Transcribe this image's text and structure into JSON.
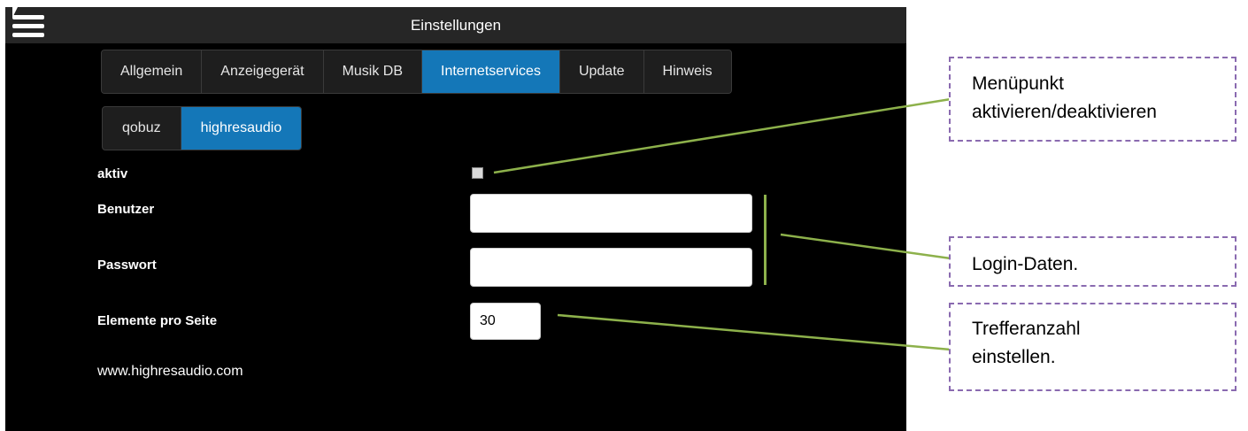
{
  "window": {
    "title": "Einstellungen"
  },
  "main_tabs": [
    {
      "label": "Allgemein",
      "active": false
    },
    {
      "label": "Anzeigegerät",
      "active": false
    },
    {
      "label": "Musik DB",
      "active": false
    },
    {
      "label": "Internetservices",
      "active": true
    },
    {
      "label": "Update",
      "active": false
    },
    {
      "label": "Hinweis",
      "active": false
    }
  ],
  "sub_tabs": [
    {
      "label": "qobuz",
      "active": false
    },
    {
      "label": "highresaudio",
      "active": true
    }
  ],
  "form": {
    "active_label": "aktiv",
    "active_checked": false,
    "user_label": "Benutzer",
    "user_value": "",
    "password_label": "Passwort",
    "password_value": "",
    "items_per_page_label": "Elemente pro Seite",
    "items_per_page_value": "30",
    "link_text": "www.highresaudio.com"
  },
  "annotations": {
    "menu_toggle": [
      "Menüpunkt",
      "aktivieren/deaktivieren"
    ],
    "login": [
      "Login-Daten."
    ],
    "results": [
      "Trefferanzahl",
      "einstellen."
    ]
  },
  "colors": {
    "accent": "#1477b8",
    "arrow": "#8db14b",
    "annotation_border": "#8a6ab0",
    "panel_bg": "#000000",
    "titlebar_bg": "#262626"
  },
  "icons": {
    "menu": "hamburger-icon",
    "pointer": "cursor-icon"
  }
}
